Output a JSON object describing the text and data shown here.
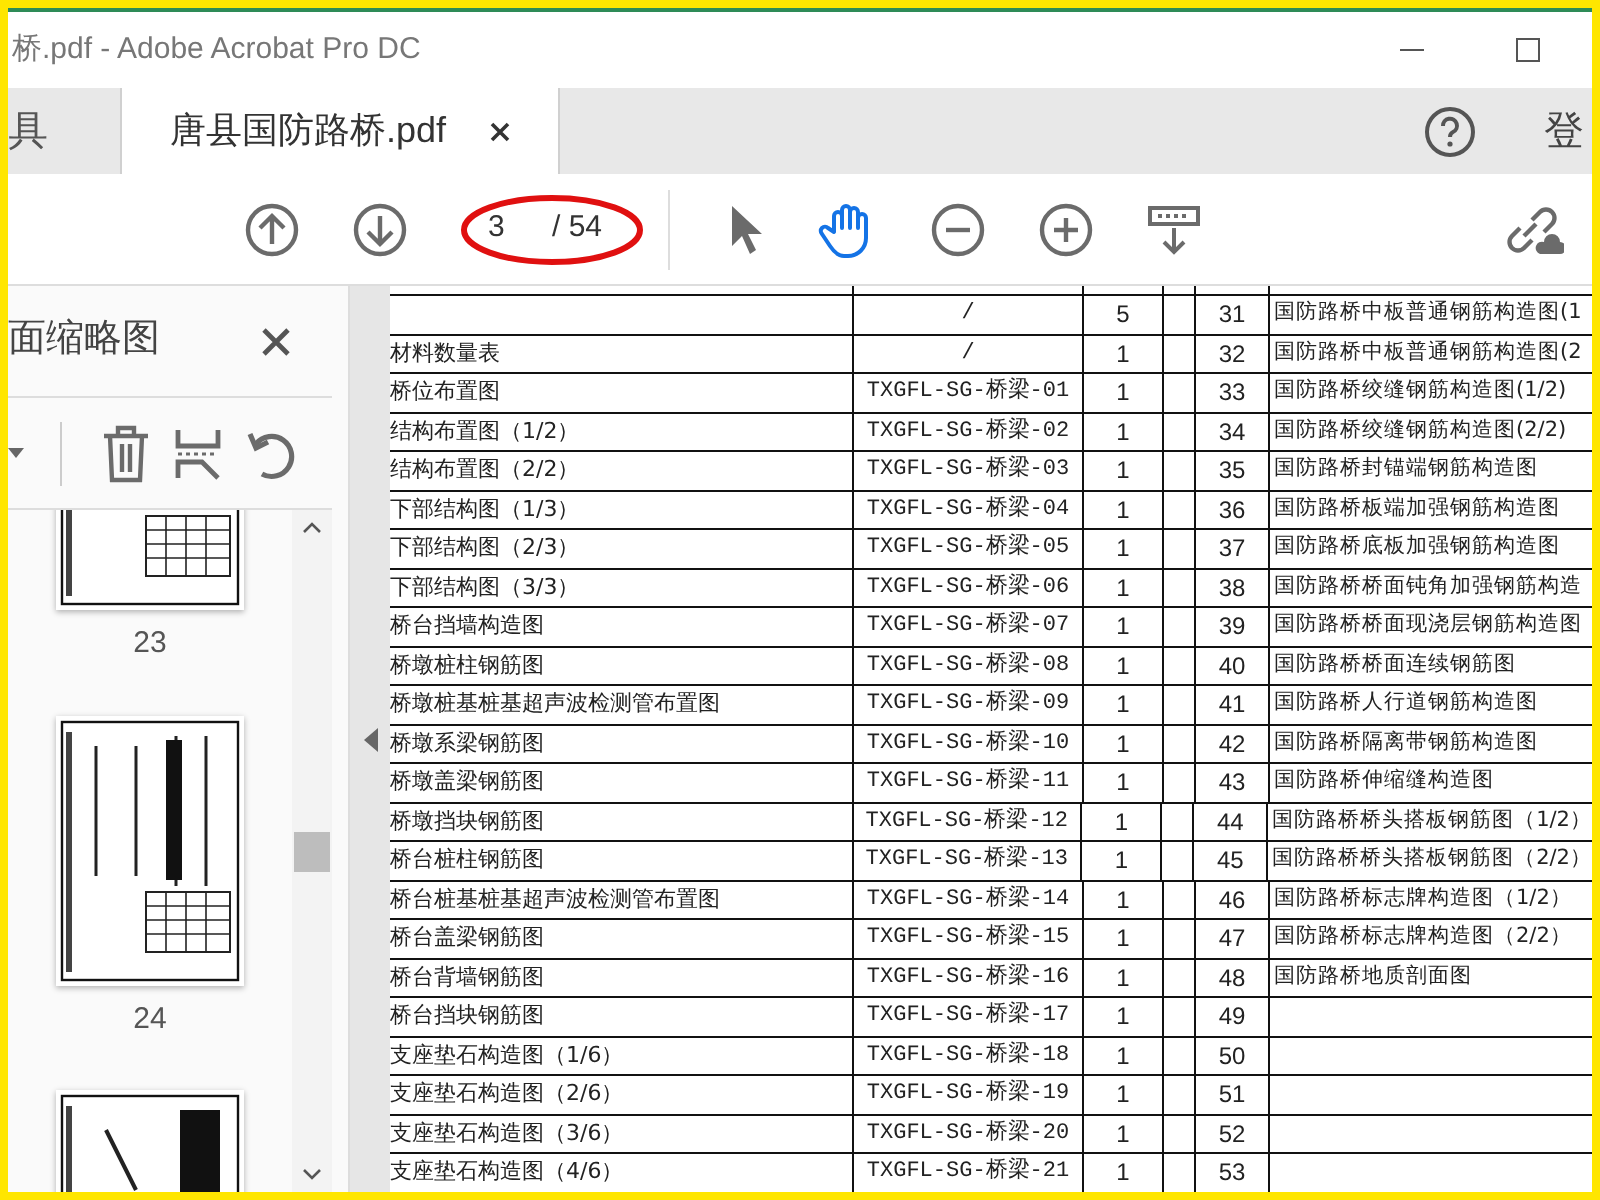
{
  "window": {
    "title": "桥.pdf - Adobe Acrobat Pro DC"
  },
  "tabs": [
    {
      "label": "具",
      "selected": false,
      "closable": false
    },
    {
      "label": "唐县国防路桥.pdf",
      "selected": true,
      "closable": true
    }
  ],
  "sign_in": "登",
  "toolbar": {
    "page": "3",
    "total": "/ 54",
    "tools": [
      {
        "kind": "select",
        "selected": false
      },
      {
        "kind": "hand",
        "selected": true
      },
      {
        "kind": "zoom-out",
        "selected": false
      },
      {
        "kind": "zoom-in",
        "selected": false
      },
      {
        "kind": "scroll-mode",
        "selected": false
      }
    ]
  },
  "sidebar": {
    "title": "面缩略图",
    "thumbnails": [
      {
        "label": "23"
      },
      {
        "label": "24"
      }
    ]
  },
  "left_table": [
    {
      "code": "/",
      "count": "5"
    },
    {
      "name": "材料数量表",
      "code": "/",
      "count": "1"
    },
    {
      "name": "桥位布置图",
      "code": "TXGFL-SG-桥梁-01",
      "count": "1"
    },
    {
      "name": "结构布置图（1/2）",
      "code": "TXGFL-SG-桥梁-02",
      "count": "1"
    },
    {
      "name": "结构布置图（2/2）",
      "code": "TXGFL-SG-桥梁-03",
      "count": "1"
    },
    {
      "name": "下部结构图（1/3）",
      "code": "TXGFL-SG-桥梁-04",
      "count": "1"
    },
    {
      "name": "下部结构图（2/3）",
      "code": "TXGFL-SG-桥梁-05",
      "count": "1"
    },
    {
      "name": "下部结构图（3/3）",
      "code": "TXGFL-SG-桥梁-06",
      "count": "1"
    },
    {
      "name": "桥台挡墙构造图",
      "code": "TXGFL-SG-桥梁-07",
      "count": "1"
    },
    {
      "name": "桥墩桩柱钢筋图",
      "code": "TXGFL-SG-桥梁-08",
      "count": "1"
    },
    {
      "name": "桥墩桩基桩基超声波检测管布置图",
      "code": "TXGFL-SG-桥梁-09",
      "count": "1"
    },
    {
      "name": "桥墩系梁钢筋图",
      "code": "TXGFL-SG-桥梁-10",
      "count": "1"
    },
    {
      "name": "桥墩盖梁钢筋图",
      "code": "TXGFL-SG-桥梁-11",
      "count": "1"
    },
    {
      "name": "桥墩挡块钢筋图",
      "code": "TXGFL-SG-桥梁-12",
      "count": "1"
    },
    {
      "name": "桥台桩柱钢筋图",
      "code": "TXGFL-SG-桥梁-13",
      "count": "1"
    },
    {
      "name": "桥台桩基桩基超声波检测管布置图",
      "code": "TXGFL-SG-桥梁-14",
      "count": "1"
    },
    {
      "name": "桥台盖梁钢筋图",
      "code": "TXGFL-SG-桥梁-15",
      "count": "1"
    },
    {
      "name": "桥台背墙钢筋图",
      "code": "TXGFL-SG-桥梁-16",
      "count": "1"
    },
    {
      "name": "桥台挡块钢筋图",
      "code": "TXGFL-SG-桥梁-17",
      "count": "1"
    },
    {
      "name": "支座垫石构造图（1/6）",
      "code": "TXGFL-SG-桥梁-18",
      "count": "1"
    },
    {
      "name": "支座垫石构造图（2/6）",
      "code": "TXGFL-SG-桥梁-19",
      "count": "1"
    },
    {
      "name": "支座垫石构造图（3/6）",
      "code": "TXGFL-SG-桥梁-20",
      "count": "1"
    },
    {
      "name": "支座垫石构造图（4/6）",
      "code": "TXGFL-SG-桥梁-21",
      "count": "1"
    }
  ],
  "right_table": [
    {
      "no": "31",
      "name": "国防路桥中板普通钢筋构造图(1"
    },
    {
      "no": "32",
      "name": "国防路桥中板普通钢筋构造图(2"
    },
    {
      "no": "33",
      "name": "国防路桥绞缝钢筋构造图(1/2)"
    },
    {
      "no": "34",
      "name": "国防路桥绞缝钢筋构造图(2/2)"
    },
    {
      "no": "35",
      "name": "国防路桥封锚端钢筋构造图"
    },
    {
      "no": "36",
      "name": "国防路桥板端加强钢筋构造图"
    },
    {
      "no": "37",
      "name": "国防路桥底板加强钢筋构造图"
    },
    {
      "no": "38",
      "name": "国防路桥桥面钝角加强钢筋构造"
    },
    {
      "no": "39",
      "name": "国防路桥桥面现浇层钢筋构造图"
    },
    {
      "no": "40",
      "name": "国防路桥桥面连续钢筋图"
    },
    {
      "no": "41",
      "name": "国防路桥人行道钢筋构造图"
    },
    {
      "no": "42",
      "name": "国防路桥隔离带钢筋构造图"
    },
    {
      "no": "43",
      "name": "国防路桥伸缩缝构造图"
    },
    {
      "no": "44",
      "name": "国防路桥桥头搭板钢筋图（1/2）"
    },
    {
      "no": "45",
      "name": "国防路桥桥头搭板钢筋图（2/2）"
    },
    {
      "no": "46",
      "name": "国防路桥标志牌构造图（1/2）"
    },
    {
      "no": "47",
      "name": "国防路桥标志牌构造图（2/2）"
    },
    {
      "no": "48",
      "name": "国防路桥地质剖面图"
    },
    {
      "no": "49"
    },
    {
      "no": "50"
    },
    {
      "no": "51"
    },
    {
      "no": "52"
    },
    {
      "no": "53"
    }
  ]
}
